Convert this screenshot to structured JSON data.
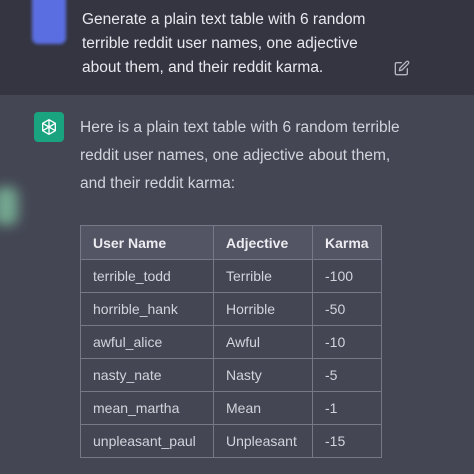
{
  "user_message": {
    "text": "Generate a plain text table with 6 random terrible reddit user names, one adjective about them, and their reddit karma."
  },
  "assistant_message": {
    "text": "Here is a plain text table with 6 random terrible reddit user names, one adjective about them, and their reddit karma:",
    "table": {
      "headers": [
        "User Name",
        "Adjective",
        "Karma"
      ],
      "rows": [
        [
          "terrible_todd",
          "Terrible",
          "-100"
        ],
        [
          "horrible_hank",
          "Horrible",
          "-50"
        ],
        [
          "awful_alice",
          "Awful",
          "-10"
        ],
        [
          "nasty_nate",
          "Nasty",
          "-5"
        ],
        [
          "mean_martha",
          "Mean",
          "-1"
        ],
        [
          "unpleasant_paul",
          "Unpleasant",
          "-15"
        ]
      ]
    }
  },
  "icons": {
    "edit": "edit-icon",
    "assistant_avatar": "openai-logo-icon"
  },
  "colors": {
    "assistant_avatar_bg": "#19a37f",
    "user_avatar_bg": "#5b6ee1",
    "user_bg": "#343541",
    "assistant_bg": "#444654"
  }
}
